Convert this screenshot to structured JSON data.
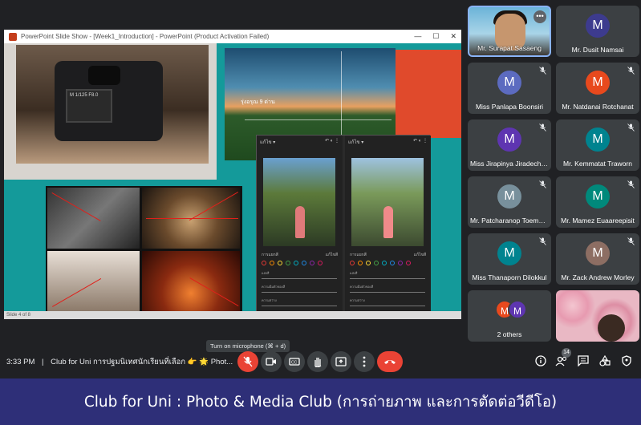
{
  "shared_window": {
    "title": "PowerPoint Slide Show - [Week1_Introduction] - PowerPoint (Product Activation Failed)",
    "status": "Slide 4 of 8",
    "camera_screen_text": "M  1/125  F8.0",
    "landscape_caption": "รุ่งอรุณ 9 ด่าน",
    "phone_top_left": "แก้ไข ▾",
    "phone_tab_left": "การแยกสี",
    "phone_tab_right": "แก้ไขสี",
    "phone_slider_1": "แสงสี",
    "phone_slider_2": "ความอิ่มตัวของสี",
    "phone_slider_3": "ความสว่าง"
  },
  "participants": [
    {
      "name": "Mr. Surapat Sasaeng",
      "initial": "",
      "color": "",
      "video": true
    },
    {
      "name": "Mr. Dusit Namsai",
      "initial": "M",
      "color": "#3d3b8e",
      "muted": false
    },
    {
      "name": "Miss Panlapa Boonsiri",
      "initial": "M",
      "color": "#5c6bc0",
      "muted": true
    },
    {
      "name": "Mr. Natdanai Rotchanat",
      "initial": "M",
      "color": "#e8491d",
      "muted": true
    },
    {
      "name": "Miss Jirapinya Jiradechakul",
      "initial": "M",
      "color": "#5e35b1",
      "muted": true
    },
    {
      "name": "Mr. Kemmatat Traworn",
      "initial": "M",
      "color": "#00838f",
      "muted": true
    },
    {
      "name": "Mr. Patcharanop Toempuek",
      "initial": "M",
      "color": "#78909c",
      "muted": true
    },
    {
      "name": "Mr. Mamez Euaareepisit",
      "initial": "M",
      "color": "#00897b",
      "muted": true
    },
    {
      "name": "Miss Thanaporn Dilokkul",
      "initial": "M",
      "color": "#00838f",
      "muted": true
    },
    {
      "name": "Mr. Zack Andrew Morley",
      "initial": "M",
      "color": "#8d6e63",
      "muted": true
    },
    {
      "name": "2 others",
      "initial": "M",
      "color": "#e8491d",
      "initial2": "M",
      "color2": "#5e35b1"
    },
    {
      "name": "",
      "flowers": true
    }
  ],
  "bottom": {
    "time": "3:33 PM",
    "separator": "|",
    "meeting_name": "Club for Uni การปฐมนิเทศนักเรียนที่เลือก 👉 🌟 Phot...",
    "tooltip": "Turn on microphone (⌘ + d)",
    "people_count": "14"
  },
  "banner": "Club for Uni : Photo & Media Club (การถ่ายภาพ และการตัดต่อวีดีโอ)",
  "colors": {
    "accent": "#8ab4f8",
    "danger": "#ea4335",
    "banner": "#2e2f78"
  }
}
